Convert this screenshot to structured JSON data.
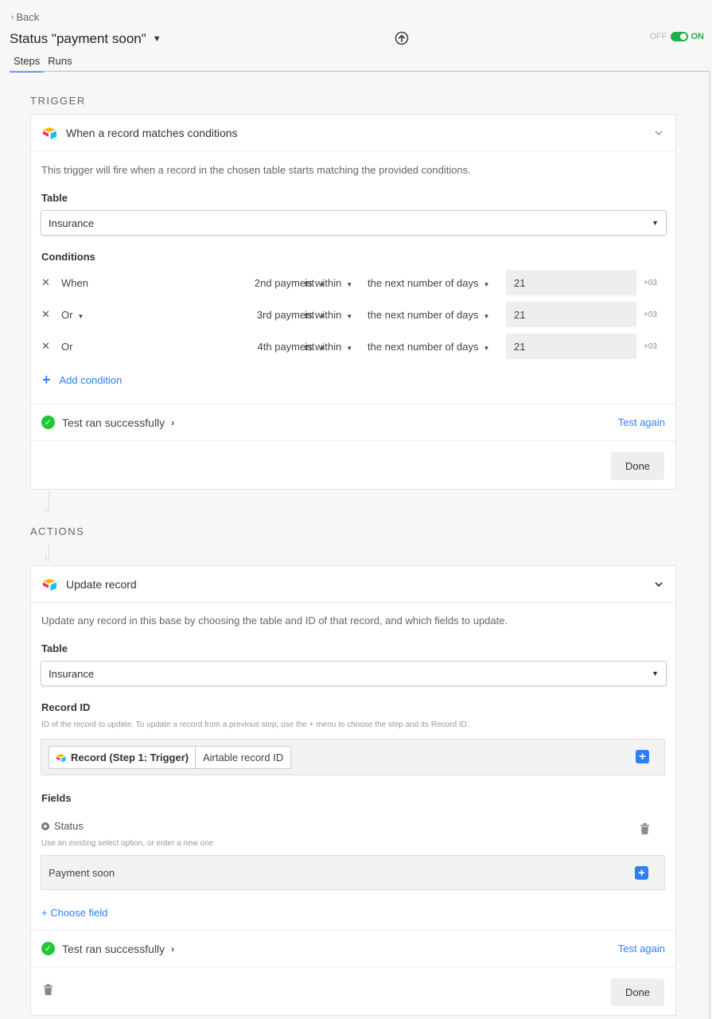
{
  "header": {
    "back_label": "Back",
    "title": "Status \"payment soon\"",
    "toggle_off": "OFF",
    "toggle_on": "ON",
    "tabs": [
      {
        "label": "Steps"
      },
      {
        "label": "Runs"
      }
    ]
  },
  "trigger": {
    "section_label": "TRIGGER",
    "title": "When a record matches conditions",
    "description": "This trigger will fire when a record in the chosen table starts matching the provided conditions.",
    "table_label": "Table",
    "table_value": "Insurance",
    "conditions_label": "Conditions",
    "conditions": [
      {
        "word": "When",
        "field": "2nd payment",
        "operator": "is within",
        "mode": "the next number of days",
        "value": "21",
        "tz": "+03"
      },
      {
        "word": "Or",
        "field": "3rd payment",
        "operator": "is within",
        "mode": "the next number of days",
        "value": "21",
        "tz": "+03"
      },
      {
        "word": "Or",
        "field": "4th payment",
        "operator": "is within",
        "mode": "the next number of days",
        "value": "21",
        "tz": "+03"
      }
    ],
    "add_condition": "Add condition",
    "test_status": "Test ran successfully",
    "test_again": "Test again",
    "done": "Done"
  },
  "actions": {
    "section_label": "ACTIONS",
    "title": "Update record",
    "description": "Update any record in this base by choosing the table and ID of that record, and which fields to update.",
    "table_label": "Table",
    "table_value": "Insurance",
    "record_id_label": "Record ID",
    "record_id_help": "ID of the record to update. To update a record from a previous step, use the + menu to choose the step and its Record ID.",
    "record_token_step": "Record (Step 1: Trigger)",
    "record_token_field": "Airtable record ID",
    "fields_label": "Fields",
    "field_name": "Status",
    "field_help": "Use an existing select option, or enter a new one",
    "field_value": "Payment soon",
    "choose_field": "+ Choose field",
    "test_status": "Test ran successfully",
    "test_again": "Test again",
    "done": "Done"
  },
  "colors": {
    "accent": "#2d7ff9",
    "success": "#20c933",
    "toggle_on": "#20b04a"
  }
}
